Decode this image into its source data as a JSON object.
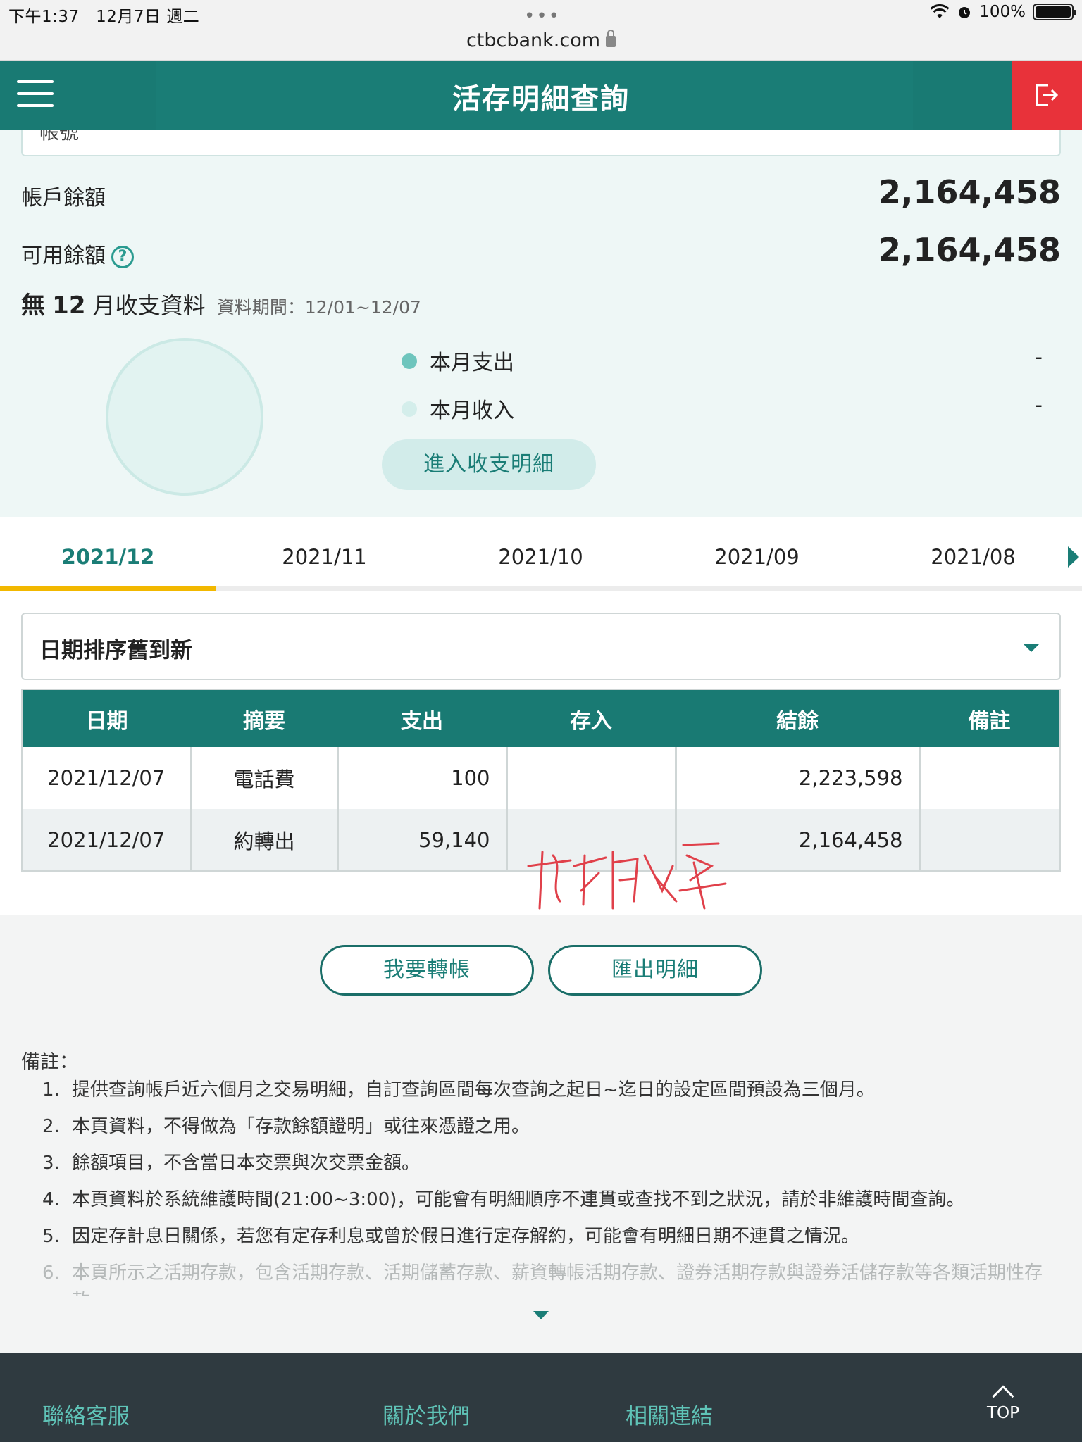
{
  "status_bar": {
    "time": "下午1:37",
    "date": "12月7日 週二",
    "url": "ctbcbank.com",
    "battery": "100%"
  },
  "header": {
    "title": "活存明細查詢"
  },
  "summary": {
    "account_label": "帳號",
    "account_balance_label": "帳戶餘額",
    "account_balance": "2,164,458",
    "available_balance_label": "可用餘額",
    "available_balance": "2,164,458",
    "month_prefix": "無",
    "month_number": "12",
    "month_suffix": "月收支資料",
    "period_text": "資料期間：12/01~12/07",
    "expense_label": "本月支出",
    "expense_value": "-",
    "income_label": "本月收入",
    "income_value": "-",
    "detail_button": "進入收支明細",
    "colors": {
      "expense": "#6ec5bd",
      "income": "#d4eeeb"
    }
  },
  "tabs": [
    {
      "label": "2021/12",
      "active": true
    },
    {
      "label": "2021/11",
      "active": false
    },
    {
      "label": "2021/10",
      "active": false
    },
    {
      "label": "2021/09",
      "active": false
    },
    {
      "label": "2021/08",
      "active": false
    }
  ],
  "sort": {
    "selected": "日期排序舊到新"
  },
  "table": {
    "headers": [
      "日期",
      "摘要",
      "支出",
      "存入",
      "結餘",
      "備註"
    ],
    "rows": [
      {
        "date": "2021/12/07",
        "desc": "電話費",
        "out": "100",
        "in": "",
        "balance": "2,223,598",
        "note": ""
      },
      {
        "date": "2021/12/07",
        "desc": "約轉出",
        "out": "59,140",
        "in": "",
        "balance": "2,164,458",
        "note": ""
      }
    ]
  },
  "actions": {
    "transfer": "我要轉帳",
    "export": "匯出明細"
  },
  "notes": {
    "title": "備註：",
    "items": [
      "提供查詢帳戶近六個月之交易明細，自訂查詢區間每次查詢之起日~迄日的設定區間預設為三個月。",
      "本頁資料，不得做為「存款餘額證明」或往來憑證之用。",
      "餘額項目，不含當日本交票與次交票金額。",
      "本頁資料於系統維護時間(21:00~3:00)，可能會有明細順序不連貫或查找不到之狀況，請於非維護時間查詢。",
      "因定存計息日關係，若您有定存利息或曾於假日進行定存解約，可能會有明細日期不連貫之情況。",
      "本頁所示之活期存款，包含活期存款、活期儲蓄存款、薪資轉帳活期存款、證券活期存款與證券活儲存款等各類活期性存款。"
    ]
  },
  "footer": {
    "contact": "聯絡客服",
    "about": "關於我們",
    "links": "相關連結",
    "top": "TOP"
  },
  "colors": {
    "brand": "#197a73",
    "logout": "#e8323a",
    "tab_indicator": "#f2b800",
    "footer_bg": "#2f3a40",
    "footer_link": "#5fc3b7"
  }
}
